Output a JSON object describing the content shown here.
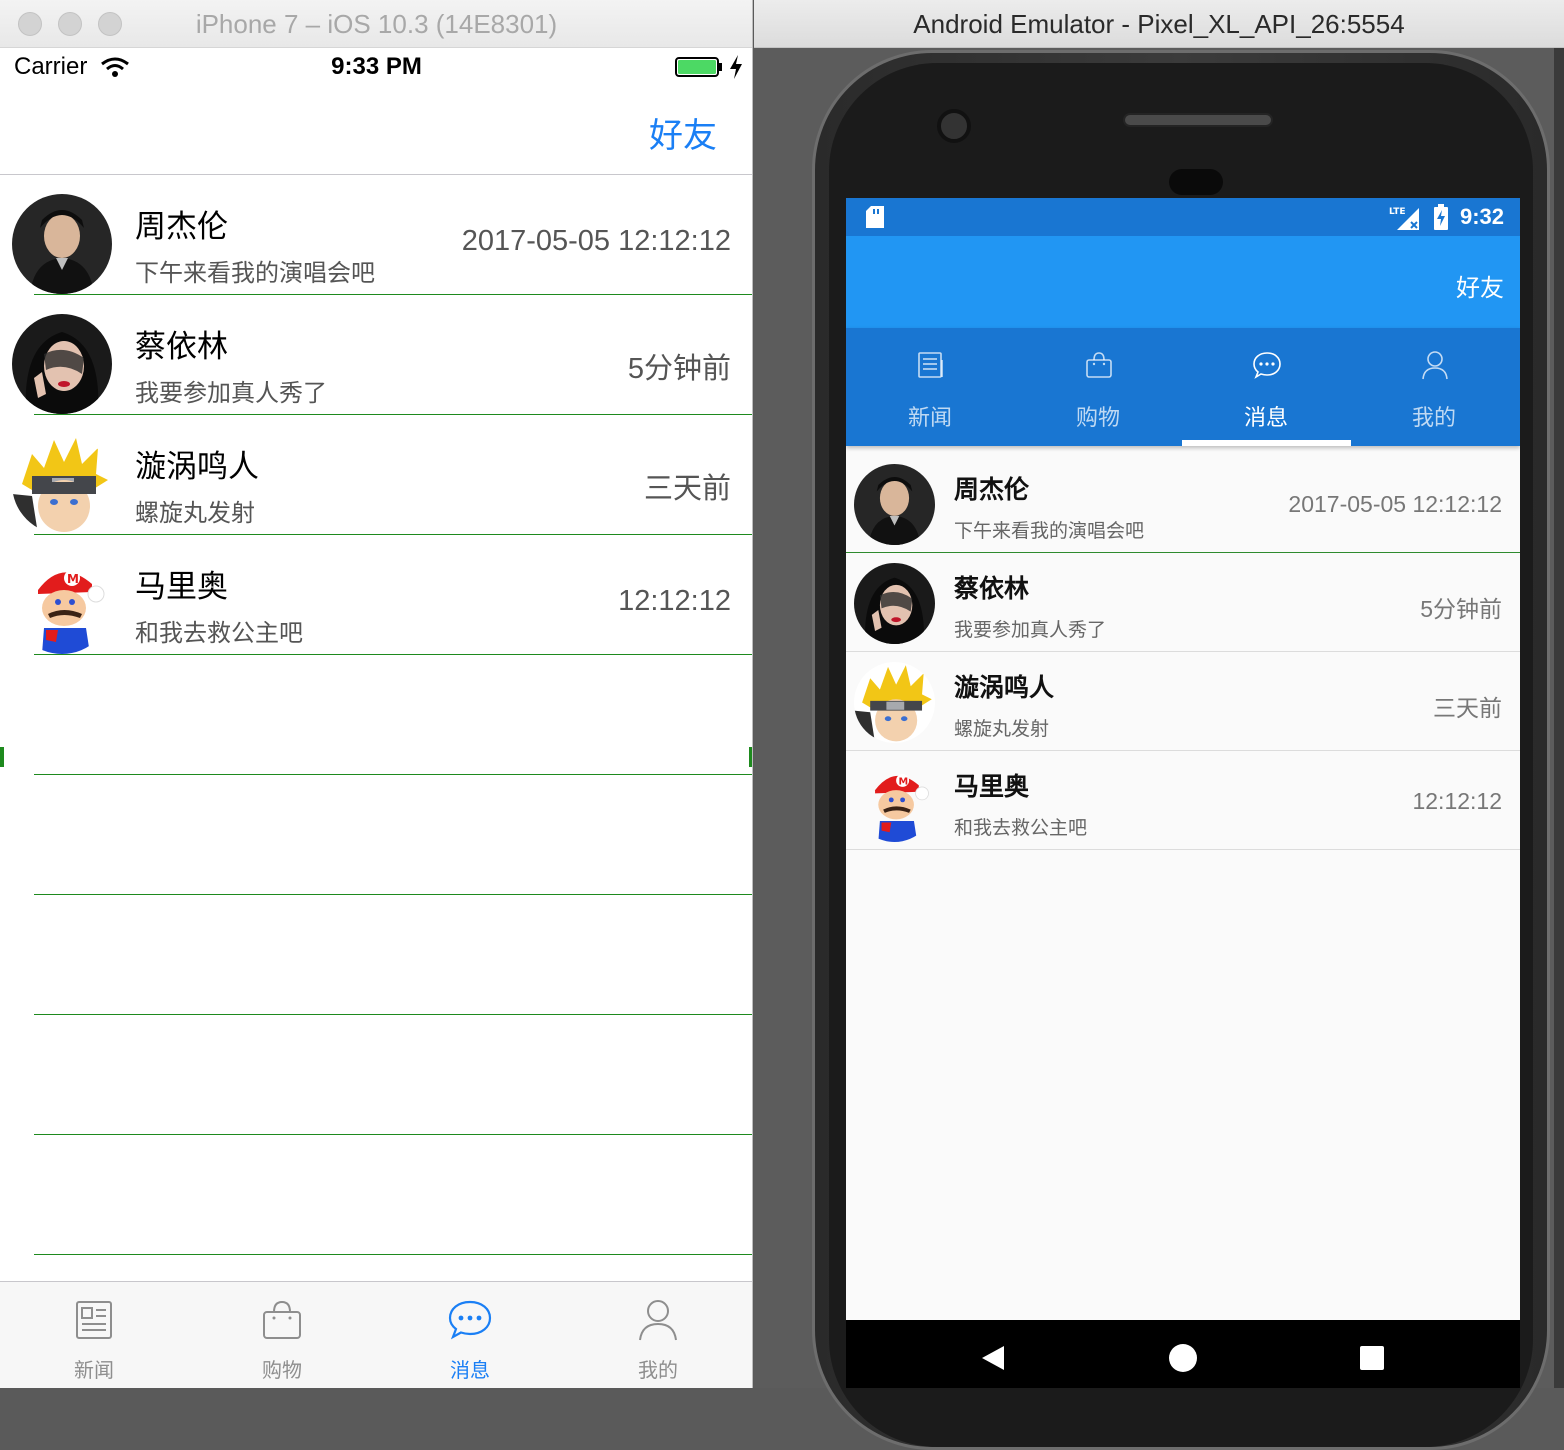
{
  "ios": {
    "window_title": "iPhone 7 – iOS 10.3 (14E8301)",
    "status": {
      "carrier": "Carrier",
      "time": "9:33 PM"
    },
    "nav": {
      "right_button": "好友"
    },
    "contacts": [
      {
        "name": "周杰伦",
        "message": "下午来看我的演唱会吧",
        "time": "2017-05-05 12:12:12",
        "avatar": "jay-chou"
      },
      {
        "name": "蔡依林",
        "message": "我要参加真人秀了",
        "time": "5分钟前",
        "avatar": "jolin"
      },
      {
        "name": "漩涡鸣人",
        "message": "螺旋丸发射",
        "time": "三天前",
        "avatar": "naruto"
      },
      {
        "name": "马里奥",
        "message": "和我去救公主吧",
        "time": "12:12:12",
        "avatar": "mario"
      }
    ],
    "tabs": [
      {
        "label": "新闻",
        "icon": "news-icon"
      },
      {
        "label": "购物",
        "icon": "shopping-bag-icon"
      },
      {
        "label": "消息",
        "icon": "message-icon",
        "active": true
      },
      {
        "label": "我的",
        "icon": "person-icon"
      }
    ],
    "accent": "#1a7ff5"
  },
  "android": {
    "window_title": "Android Emulator - Pixel_XL_API_26:5554",
    "status": {
      "time": "9:32"
    },
    "appbar": {
      "right_button": "好友"
    },
    "tabs": [
      {
        "label": "新闻",
        "icon": "news-icon"
      },
      {
        "label": "购物",
        "icon": "shopping-bag-icon"
      },
      {
        "label": "消息",
        "icon": "message-icon",
        "active": true
      },
      {
        "label": "我的",
        "icon": "person-icon"
      }
    ],
    "contacts": [
      {
        "name": "周杰伦",
        "message": "下午来看我的演唱会吧",
        "time": "2017-05-05 12:12:12",
        "avatar": "jay-chou"
      },
      {
        "name": "蔡依林",
        "message": "我要参加真人秀了",
        "time": "5分钟前",
        "avatar": "jolin"
      },
      {
        "name": "漩涡鸣人",
        "message": "螺旋丸发射",
        "time": "三天前",
        "avatar": "naruto"
      },
      {
        "name": "马里奥",
        "message": "和我去救公主吧",
        "time": "12:12:12",
        "avatar": "mario"
      }
    ],
    "primary": "#1976d2",
    "appbar_color": "#2196f3"
  }
}
